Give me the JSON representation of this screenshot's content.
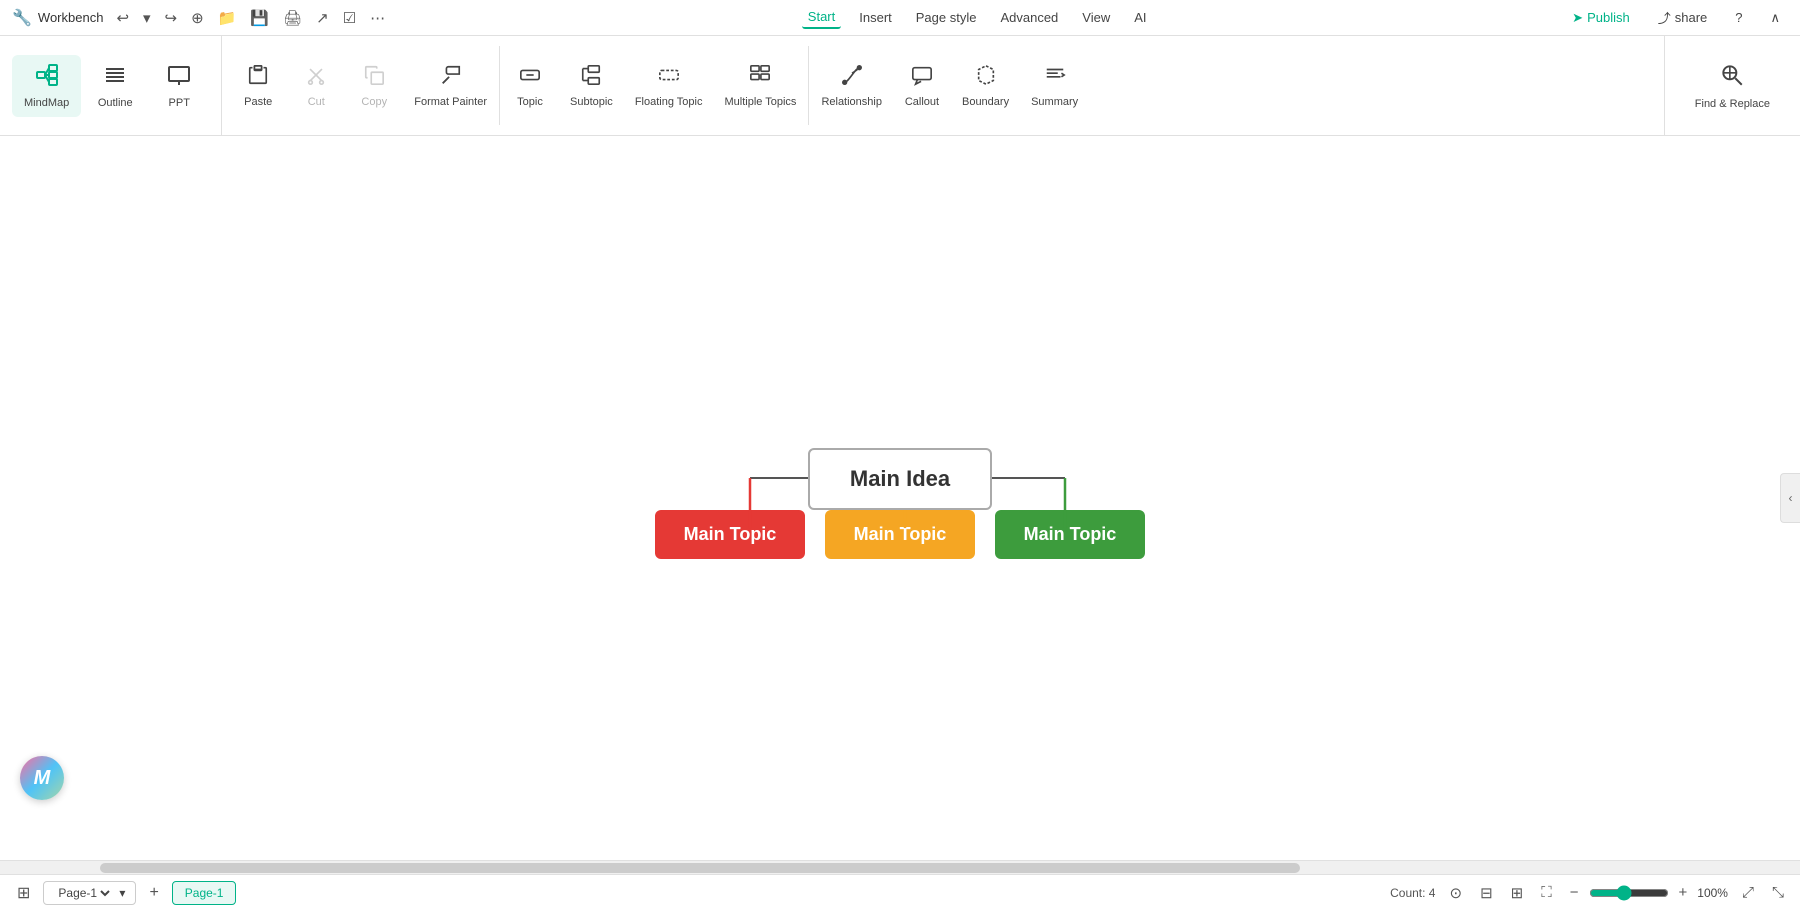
{
  "titlebar": {
    "app_name": "Workbench",
    "nav": [
      {
        "id": "start",
        "label": "Start",
        "active": true
      },
      {
        "id": "insert",
        "label": "Insert",
        "active": false
      },
      {
        "id": "page_style",
        "label": "Page style",
        "active": false
      },
      {
        "id": "advanced",
        "label": "Advanced",
        "active": false
      },
      {
        "id": "view",
        "label": "View",
        "active": false
      },
      {
        "id": "ai",
        "label": "AI",
        "active": false
      }
    ],
    "publish_label": "Publish",
    "share_label": "share",
    "help_label": "?",
    "collapse_label": "∧"
  },
  "toolbar": {
    "view_group": [
      {
        "id": "mindmap",
        "label": "MindMap",
        "icon": "⊞",
        "active": true
      },
      {
        "id": "outline",
        "label": "Outline",
        "icon": "☰",
        "active": false
      },
      {
        "id": "ppt",
        "label": "PPT",
        "icon": "▭",
        "active": false
      }
    ],
    "tools": [
      {
        "id": "paste",
        "label": "Paste",
        "icon": "📋",
        "disabled": false
      },
      {
        "id": "cut",
        "label": "Cut",
        "icon": "✂",
        "disabled": true
      },
      {
        "id": "copy",
        "label": "Copy",
        "icon": "⎘",
        "disabled": true
      },
      {
        "id": "format_painter",
        "label": "Format Painter",
        "icon": "🖌",
        "disabled": false
      },
      {
        "id": "topic",
        "label": "Topic",
        "icon": "⬜",
        "disabled": false
      },
      {
        "id": "subtopic",
        "label": "Subtopic",
        "icon": "⬛",
        "disabled": false
      },
      {
        "id": "floating_topic",
        "label": "Floating Topic",
        "icon": "⬜",
        "disabled": false
      },
      {
        "id": "multiple_topics",
        "label": "Multiple Topics",
        "icon": "⊞",
        "disabled": false
      },
      {
        "id": "relationship",
        "label": "Relationship",
        "icon": "↗",
        "disabled": false
      },
      {
        "id": "callout",
        "label": "Callout",
        "icon": "💬",
        "disabled": false
      },
      {
        "id": "boundary",
        "label": "Boundary",
        "icon": "⬡",
        "disabled": false
      },
      {
        "id": "summary",
        "label": "Summary",
        "icon": "≡",
        "disabled": false
      }
    ],
    "find_replace": {
      "label": "Find & Replace",
      "icon": "🔍"
    }
  },
  "mindmap": {
    "main_idea": "Main Idea",
    "topics": [
      {
        "id": "topic1",
        "label": "Main Topic",
        "color": "#e53935"
      },
      {
        "id": "topic2",
        "label": "Main Topic",
        "color": "#f5a623"
      },
      {
        "id": "topic3",
        "label": "Main Topic",
        "color": "#3d9c3d"
      }
    ]
  },
  "statusbar": {
    "count_label": "Count: 4",
    "page_label": "Page-1",
    "active_page_label": "Page-1",
    "zoom_value": "100%",
    "add_page_label": "+"
  }
}
